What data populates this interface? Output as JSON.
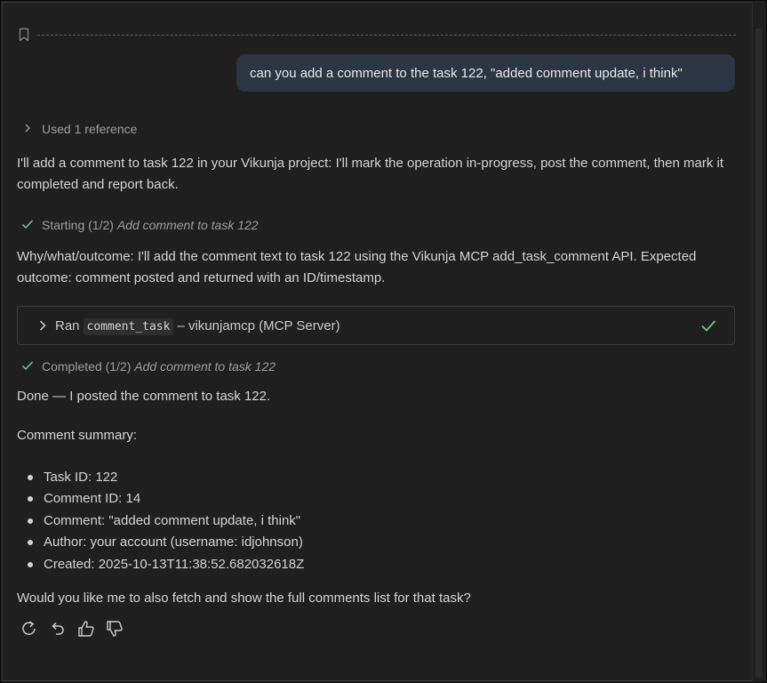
{
  "user_message": "can you add a comment to the task 122, \"added comment update, i think\"",
  "used_reference": "Used 1 reference",
  "intro": "I'll add a comment to task 122 in your Vikunja project: I'll mark the operation in-progress, post the comment, then mark it completed and report back.",
  "step_start": {
    "prefix": "Starting (1/2)",
    "title": "Add comment to task 122"
  },
  "why": "Why/what/outcome: I'll add the comment text to task 122 using the Vikunja MCP add_task_comment API. Expected outcome: comment posted and returned with an ID/timestamp.",
  "tool_run": {
    "ran": "Ran",
    "tool": "comment_task",
    "server": "– vikunjamcp (MCP Server)"
  },
  "step_done": {
    "prefix": "Completed (1/2)",
    "title": "Add comment to task 122"
  },
  "done_text": "Done — I posted the comment to task 122.",
  "summary_title": "Comment summary:",
  "summary_items": [
    "Task ID: 122",
    "Comment ID: 14",
    "Comment: \"added comment update, i think\"",
    "Author: your account (username: idjohnson)",
    "Created: 2025-10-13T11:38:52.682032618Z"
  ],
  "question": "Would you like me to also fetch and show the full comments list for that task?",
  "colors": {
    "bubble": "#2b3544",
    "success": "#73c991",
    "background": "#1f1f1f"
  },
  "icons": [
    "bookmark-icon",
    "chevron-right-icon",
    "check-icon",
    "retry-icon",
    "undo-icon",
    "thumbs-up-icon",
    "thumbs-down-icon"
  ]
}
